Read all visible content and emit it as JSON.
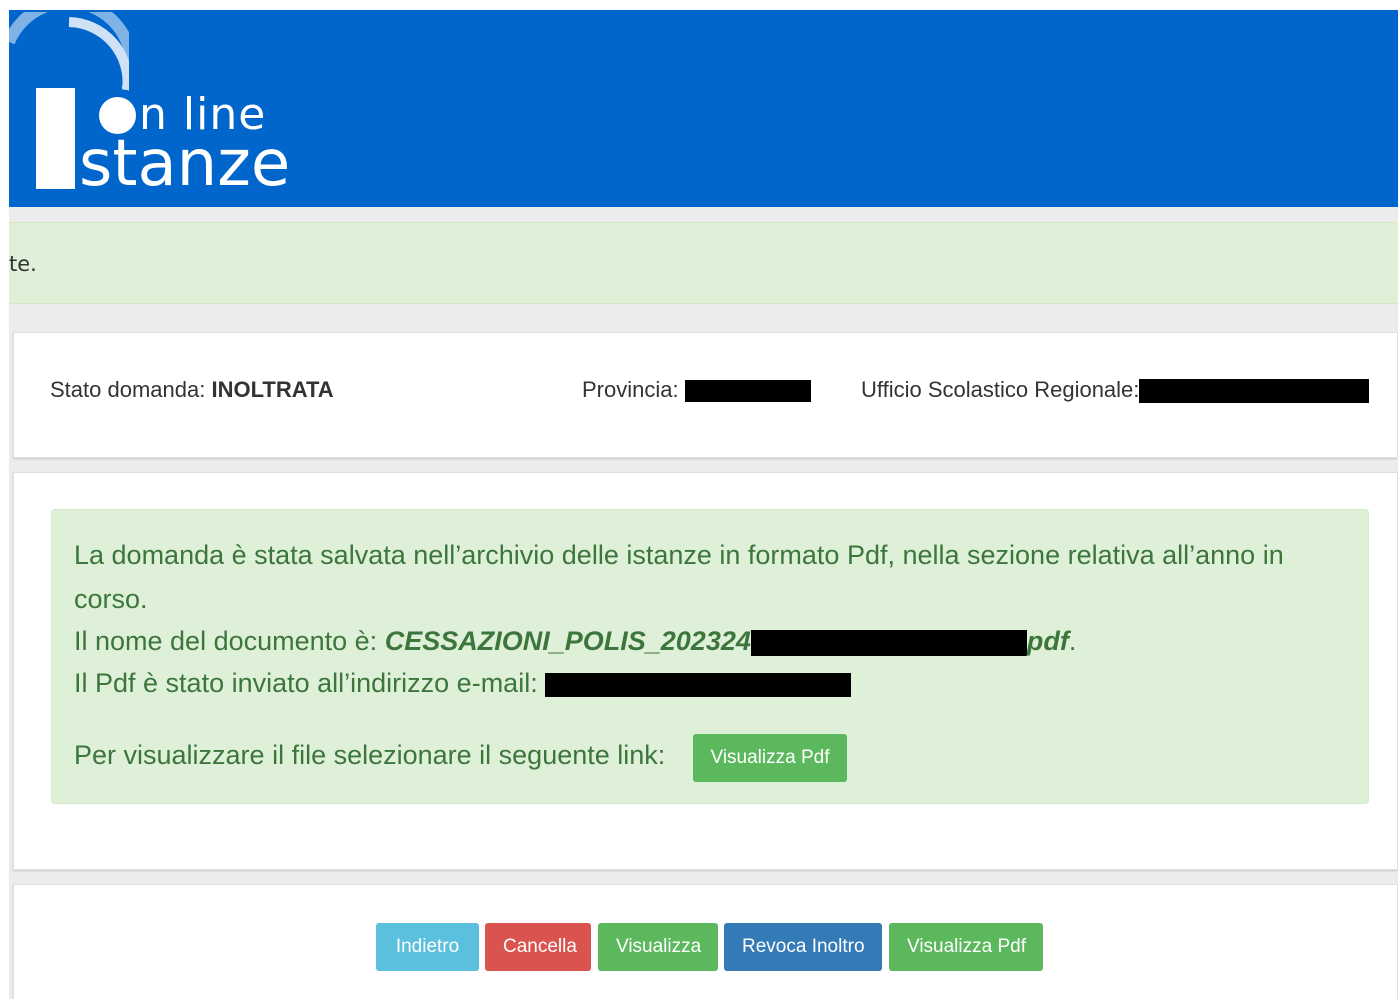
{
  "header": {
    "logo_online": "n line",
    "logo_stanze": "stanze"
  },
  "alert": {
    "text": "te."
  },
  "status": {
    "stato_label": "Stato domanda:",
    "stato_value": "INOLTRATA",
    "provincia_label": "Provincia:",
    "ufficio_label": "Ufficio Scolastico Regionale:"
  },
  "message": {
    "line1": "La domanda è stata salvata nell’archivio delle istanze in formato Pdf, nella sezione relativa all’anno in",
    "line2": "corso.",
    "doc_label": "Il nome del documento è:",
    "doc_name_start": "CESSAZIONI_POLIS_202324",
    "doc_name_end": "pdf",
    "doc_suffix": ".",
    "email_label": "Il Pdf è stato inviato all’indirizzo e-mail:",
    "link_label": "Per visualizzare il file selezionare il seguente link:",
    "link_button": "Visualizza Pdf"
  },
  "actions": {
    "indietro": "Indietro",
    "cancella": "Cancella",
    "visualizza": "Visualizza",
    "revoca_inoltro": "Revoca Inoltro",
    "visualizza_pdf": "Visualizza Pdf"
  },
  "colors": {
    "header_blue": "#0066cc",
    "success_bg": "#dff0d8",
    "success_text": "#3c763d",
    "btn_info": "#5bc0de",
    "btn_danger": "#d9534f",
    "btn_success": "#5cb85c",
    "btn_primary": "#337ab7"
  }
}
